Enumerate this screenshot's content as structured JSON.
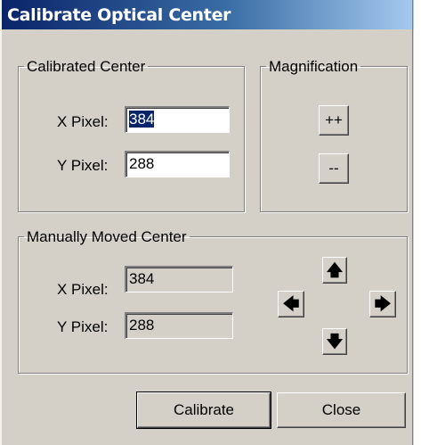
{
  "window": {
    "title": "Calibrate Optical Center"
  },
  "calibrated_center": {
    "legend": "Calibrated Center",
    "x_label": "X Pixel:",
    "x_value": "384",
    "y_label": "Y Pixel:",
    "y_value": "288"
  },
  "magnification": {
    "legend": "Magnification",
    "zoom_in_label": "++",
    "zoom_out_label": "--"
  },
  "manual_center": {
    "legend": "Manually Moved Center",
    "x_label": "X Pixel:",
    "x_value": "384",
    "y_label": "Y Pixel:",
    "y_value": "288"
  },
  "arrows": {
    "up": "🡅",
    "left": "🡄",
    "right": "🡆",
    "down": "🡇"
  },
  "icons": {
    "up": "arrow-up-icon",
    "left": "arrow-left-icon",
    "right": "arrow-right-icon",
    "down": "arrow-down-icon"
  },
  "buttons": {
    "calibrate": "Calibrate",
    "close": "Close"
  },
  "colors": {
    "face": "#d4d0c8",
    "title_start": "#0a246a",
    "title_end": "#a6caf0",
    "selection": "#0a246a"
  }
}
